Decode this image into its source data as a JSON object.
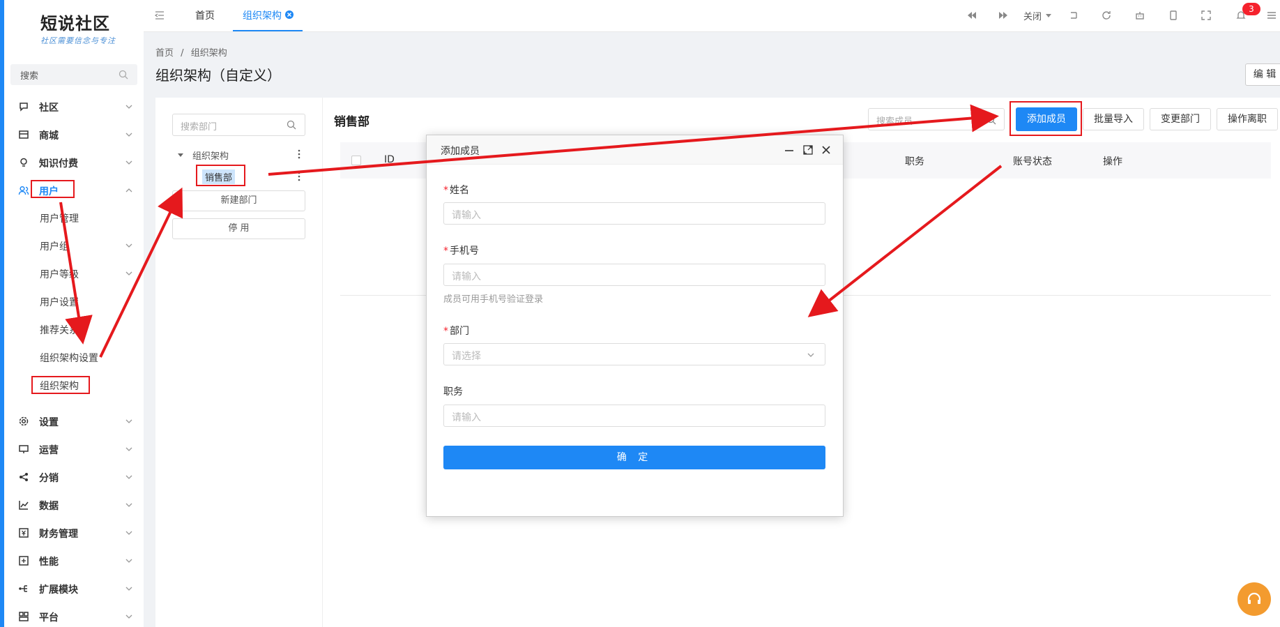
{
  "logo": {
    "title": "短说社区",
    "slogan": "社区需要信念与专注"
  },
  "sidebar": {
    "search_placeholder": "搜索",
    "menu": [
      {
        "label": "社区",
        "icon": "chat-bubble-icon"
      },
      {
        "label": "商城",
        "icon": "store-icon"
      },
      {
        "label": "知识付费",
        "icon": "lightbulb-icon"
      },
      {
        "label": "用户",
        "icon": "users-icon",
        "expanded": true,
        "active": true
      },
      {
        "label": "设置",
        "icon": "gear-icon"
      },
      {
        "label": "运营",
        "icon": "presentation-icon"
      },
      {
        "label": "分销",
        "icon": "share-node-icon"
      },
      {
        "label": "数据",
        "icon": "line-chart-icon"
      },
      {
        "label": "财务管理",
        "icon": "finance-icon"
      },
      {
        "label": "性能",
        "icon": "performance-icon"
      },
      {
        "label": "扩展模块",
        "icon": "extension-icon"
      },
      {
        "label": "平台",
        "icon": "platform-icon"
      }
    ],
    "user_submenu": [
      "用户管理",
      "用户组",
      "用户等级",
      "用户设置",
      "推荐关系",
      "组织架构设置",
      "组织架构"
    ]
  },
  "topbar": {
    "tabs": [
      {
        "label": "首页",
        "active": false
      },
      {
        "label": "组织架构",
        "active": true
      }
    ],
    "close_label": "关闭",
    "notification_count": "3",
    "icons": [
      "collapse-menu-icon",
      "rewind-icon",
      "fast-forward-icon",
      "caret-down-icon",
      "exit-icon",
      "refresh-icon",
      "robot-icon",
      "mobile-icon",
      "fullscreen-icon",
      "bell-icon",
      "hamburger-icon"
    ]
  },
  "page": {
    "breadcrumb": [
      "首页",
      "/",
      "组织架构"
    ],
    "title": "组织架构（自定义）",
    "edit_label": "编 辑"
  },
  "left_panel": {
    "search_placeholder": "搜索部门",
    "tree_root": "组织架构",
    "tree_child": "销售部",
    "new_dept_label": "新建部门",
    "disable_label": "停 用"
  },
  "right_panel": {
    "dept_title": "销售部",
    "search_placeholder": "搜索成员",
    "buttons": {
      "add": "添加成员",
      "import": "批量导入",
      "change": "变更部门",
      "leave": "操作离职"
    },
    "columns": [
      "ID",
      "职务",
      "账号状态",
      "操作"
    ]
  },
  "modal": {
    "title": "添加成员",
    "fields": {
      "name_label": "姓名",
      "name_placeholder": "请输入",
      "phone_label": "手机号",
      "phone_placeholder": "请输入",
      "phone_hint": "成员可用手机号验证登录",
      "dept_label": "部门",
      "dept_placeholder": "请选择",
      "job_label": "职务",
      "job_placeholder": "请输入"
    },
    "required_mark": "*",
    "confirm_label": "确 定"
  },
  "colors": {
    "primary": "#1e88f5",
    "annotation": "#e5191d",
    "badge": "#f5222d"
  }
}
